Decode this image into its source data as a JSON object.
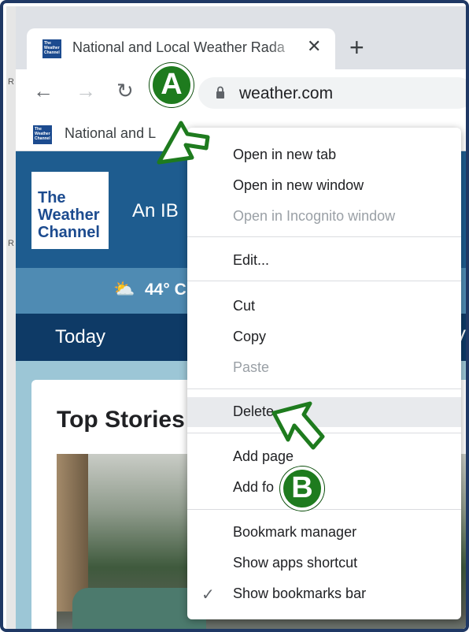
{
  "browser": {
    "tab_title": "National and Local Weather Rada",
    "tab_close_icon": "close-icon",
    "new_tab_icon": "plus-icon",
    "favicon_text": "The Weather Channel",
    "url": "weather.com",
    "bookmark_label": "National and L"
  },
  "page": {
    "logo_text": "The Weather Channel",
    "ibm_text": "An IB",
    "temp_text": "44° C",
    "nav_today": "Today",
    "nav_right_fragment": "V",
    "stories_title": "Top Stories"
  },
  "context_menu": {
    "groups": [
      [
        "Open in new tab",
        "Open in new window",
        "Open in Incognito window"
      ],
      [
        "Edit..."
      ],
      [
        "Cut",
        "Copy",
        "Paste"
      ],
      [
        "Delete"
      ],
      [
        "Add page",
        "Add fo"
      ],
      [
        "Bookmark manager",
        "Show apps shortcut",
        "Show bookmarks bar"
      ]
    ],
    "open_new_tab": "Open in new tab",
    "open_new_window": "Open in new window",
    "open_incognito": "Open in Incognito window",
    "edit": "Edit...",
    "cut": "Cut",
    "copy": "Copy",
    "paste": "Paste",
    "delete": "Delete",
    "add_page": "Add page",
    "add_folder": "Add fo",
    "bookmark_manager": "Bookmark manager",
    "show_apps_shortcut": "Show apps shortcut",
    "show_bookmarks_bar": "Show bookmarks bar",
    "checkmark": "✓"
  },
  "callouts": {
    "a": "A",
    "b": "B"
  },
  "colors": {
    "callout_green": "#1e7b1e",
    "header_blue": "#1e5c8f",
    "nav_navy": "#0e3a66",
    "frame_border": "#1f3864"
  }
}
